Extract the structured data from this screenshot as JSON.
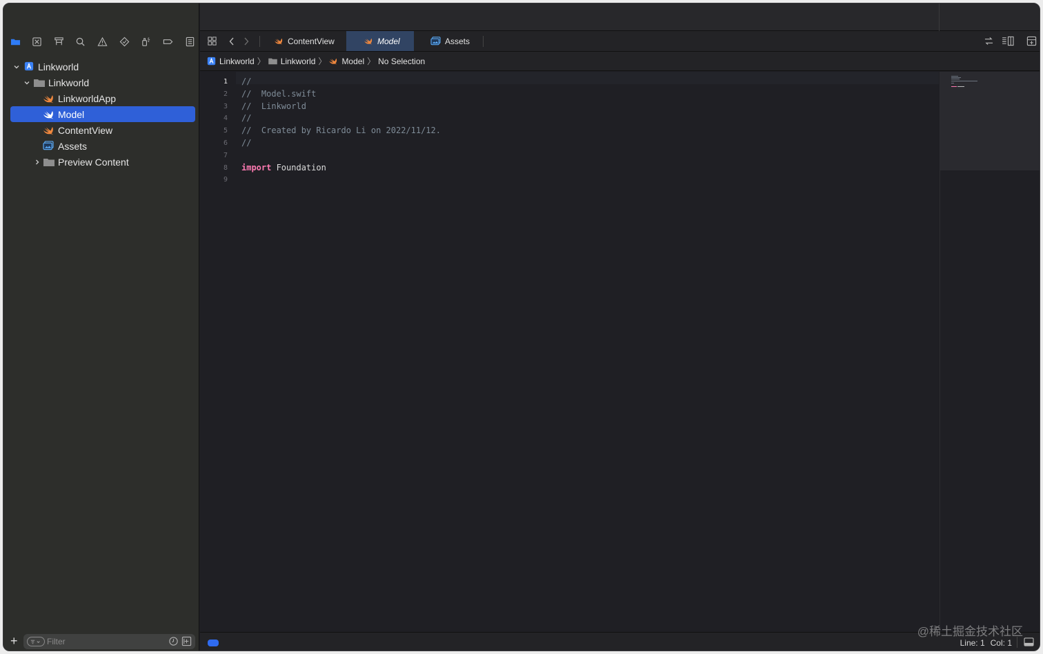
{
  "sidebar": {
    "navigators": [
      {
        "name": "project-navigator",
        "active": true
      },
      {
        "name": "source-control-navigator"
      },
      {
        "name": "symbol-navigator"
      },
      {
        "name": "find-navigator"
      },
      {
        "name": "issue-navigator"
      },
      {
        "name": "test-navigator"
      },
      {
        "name": "debug-navigator"
      },
      {
        "name": "breakpoint-navigator"
      },
      {
        "name": "report-navigator"
      }
    ],
    "tree": [
      {
        "label": "Linkworld",
        "kind": "project",
        "depth": 0,
        "expanded": true
      },
      {
        "label": "Linkworld",
        "kind": "folder",
        "depth": 1,
        "expanded": true
      },
      {
        "label": "LinkworldApp",
        "kind": "swift",
        "depth": 2
      },
      {
        "label": "Model",
        "kind": "swift",
        "depth": 2,
        "selected": true
      },
      {
        "label": "ContentView",
        "kind": "swift",
        "depth": 2
      },
      {
        "label": "Assets",
        "kind": "assets",
        "depth": 2
      },
      {
        "label": "Preview Content",
        "kind": "folder",
        "depth": 2,
        "expanded": false
      }
    ],
    "filter": {
      "placeholder": "Filter",
      "value": ""
    }
  },
  "tabs": [
    {
      "label": "ContentView",
      "kind": "swift",
      "active": false
    },
    {
      "label": "Model",
      "kind": "swift",
      "active": true
    },
    {
      "label": "Assets",
      "kind": "assets",
      "active": false
    }
  ],
  "jumpbar": {
    "items": [
      "Linkworld",
      "Linkworld",
      "Model",
      "No Selection"
    ]
  },
  "editor": {
    "current_line": 1,
    "lines": [
      {
        "n": "1",
        "text": "//",
        "type": "comment"
      },
      {
        "n": "2",
        "text": "//  Model.swift",
        "type": "comment"
      },
      {
        "n": "3",
        "text": "//  Linkworld",
        "type": "comment"
      },
      {
        "n": "4",
        "text": "//",
        "type": "comment"
      },
      {
        "n": "5",
        "text": "//  Created by Ricardo Li on 2022/11/12.",
        "type": "comment"
      },
      {
        "n": "6",
        "text": "//",
        "type": "comment"
      },
      {
        "n": "7",
        "text": "",
        "type": "blank"
      },
      {
        "n": "8",
        "keyword": "import",
        "rest": " Foundation",
        "type": "import"
      },
      {
        "n": "9",
        "text": "",
        "type": "blank"
      }
    ]
  },
  "status": {
    "line_label": "Line: 1",
    "col_label": "Col: 1"
  },
  "watermark": "@稀土掘金技术社区",
  "colors": {
    "accent": "#2f60d8",
    "swift_icon": "#f0883e",
    "keyword": "#ff7ab2",
    "comment": "#7f8c98",
    "project_icon": "#3b82f6"
  }
}
